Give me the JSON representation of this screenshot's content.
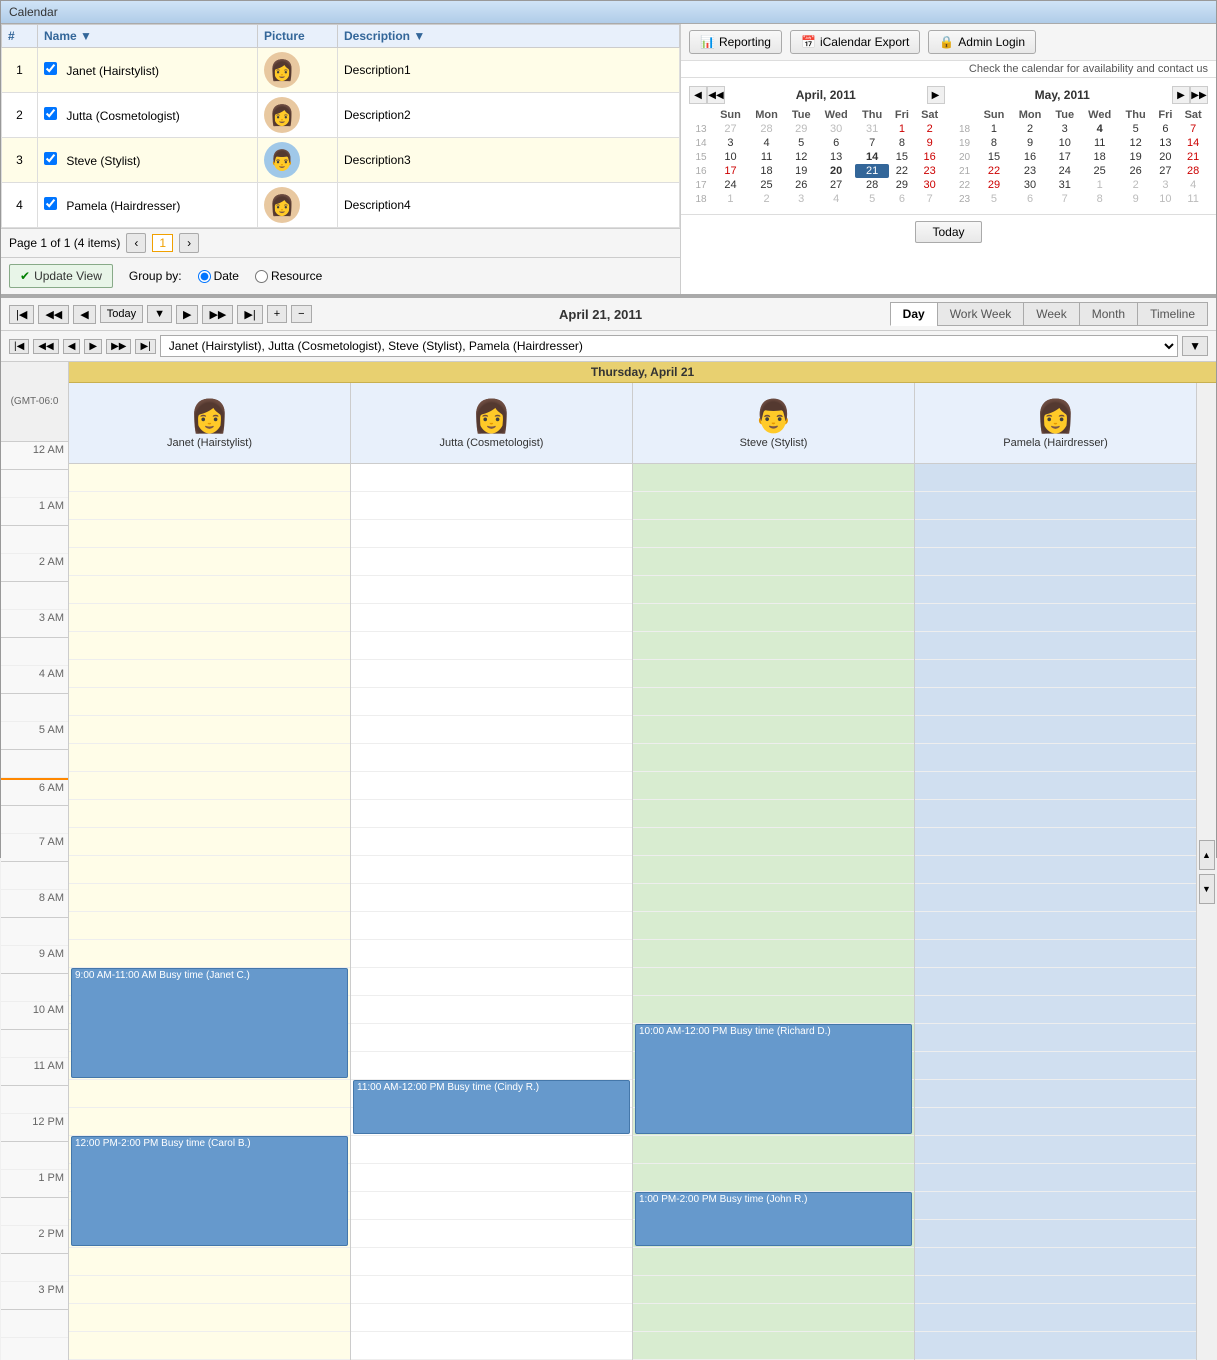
{
  "window": {
    "title": "Calendar"
  },
  "toolbar": {
    "reporting_label": "Reporting",
    "icalendar_label": "iCalendar Export",
    "admin_login_label": "Admin Login",
    "availability_text": "Check the calendar for availability and contact us"
  },
  "staff_table": {
    "columns": [
      "#",
      "Name",
      "Picture",
      "Description"
    ],
    "rows": [
      {
        "id": 1,
        "checked": true,
        "name": "Janet (Hairstylist)",
        "avatar": "👩",
        "description": "Description1",
        "gender": "female"
      },
      {
        "id": 2,
        "checked": true,
        "name": "Jutta (Cosmetologist)",
        "avatar": "👩",
        "description": "Description2",
        "gender": "female"
      },
      {
        "id": 3,
        "checked": true,
        "name": "Steve (Stylist)",
        "avatar": "👨",
        "description": "Description3",
        "gender": "male"
      },
      {
        "id": 4,
        "checked": true,
        "name": "Pamela (Hairdresser)",
        "avatar": "👩",
        "description": "Description4",
        "gender": "female"
      }
    ],
    "pagination": {
      "text": "Page 1 of 1 (4 items)",
      "current_page": "1"
    }
  },
  "controls": {
    "update_view": "Update View",
    "group_by_label": "Group by:",
    "group_date": "Date",
    "group_resource": "Resource"
  },
  "mini_calendars": {
    "april": {
      "title": "April, 2011",
      "days_header": [
        "Sun",
        "Mon",
        "Tue",
        "Wed",
        "Thu",
        "Fri",
        "Sat"
      ],
      "weeks": [
        [
          {
            "d": "27",
            "om": true
          },
          {
            "d": "28",
            "om": true
          },
          {
            "d": "29",
            "om": true
          },
          {
            "d": "30",
            "om": true
          },
          {
            "d": "31",
            "om": true
          },
          {
            "d": "1",
            "red": true
          },
          {
            "d": "2",
            "red": true
          }
        ],
        [
          {
            "d": "3"
          },
          {
            "d": "4"
          },
          {
            "d": "5"
          },
          {
            "d": "6"
          },
          {
            "d": "7"
          },
          {
            "d": "8"
          },
          {
            "d": "9",
            "red": true
          }
        ],
        [
          {
            "d": "10"
          },
          {
            "d": "11"
          },
          {
            "d": "12"
          },
          {
            "d": "13"
          },
          {
            "d": "14",
            "bold": true
          },
          {
            "d": "15"
          },
          {
            "d": "16",
            "red": true
          }
        ],
        [
          {
            "d": "17",
            "red": true
          },
          {
            "d": "18"
          },
          {
            "d": "19"
          },
          {
            "d": "20",
            "bold": true
          },
          {
            "d": "21",
            "selected": true
          },
          {
            "d": "22"
          },
          {
            "d": "23",
            "red": true
          }
        ],
        [
          {
            "d": "24"
          },
          {
            "d": "25"
          },
          {
            "d": "26"
          },
          {
            "d": "27"
          },
          {
            "d": "28"
          },
          {
            "d": "29"
          },
          {
            "d": "30",
            "red": true
          }
        ],
        [
          {
            "d": "1",
            "om": true
          },
          {
            "d": "2",
            "om": true
          },
          {
            "d": "3",
            "om": true
          },
          {
            "d": "4",
            "om": true
          },
          {
            "d": "5",
            "om": true
          },
          {
            "d": "6",
            "om": true
          },
          {
            "d": "7",
            "om": true
          }
        ]
      ],
      "week_nums": [
        "13",
        "14",
        "15",
        "16",
        "17",
        "18"
      ]
    },
    "may": {
      "title": "May, 2011",
      "days_header": [
        "Sun",
        "Mon",
        "Tue",
        "Wed",
        "Thu",
        "Fri",
        "Sat"
      ],
      "weeks": [
        [
          {
            "d": "1"
          },
          {
            "d": "2"
          },
          {
            "d": "3"
          },
          {
            "d": "4",
            "bold": true
          },
          {
            "d": "5"
          },
          {
            "d": "6"
          },
          {
            "d": "7",
            "red": true
          }
        ],
        [
          {
            "d": "8"
          },
          {
            "d": "9"
          },
          {
            "d": "10"
          },
          {
            "d": "11"
          },
          {
            "d": "12"
          },
          {
            "d": "13"
          },
          {
            "d": "14",
            "red": true
          }
        ],
        [
          {
            "d": "15"
          },
          {
            "d": "16"
          },
          {
            "d": "17"
          },
          {
            "d": "18"
          },
          {
            "d": "19"
          },
          {
            "d": "20"
          },
          {
            "d": "21",
            "red": true
          }
        ],
        [
          {
            "d": "22",
            "red": true
          },
          {
            "d": "23"
          },
          {
            "d": "24"
          },
          {
            "d": "25"
          },
          {
            "d": "26"
          },
          {
            "d": "27"
          },
          {
            "d": "28",
            "red": true
          }
        ],
        [
          {
            "d": "29",
            "red": true
          },
          {
            "d": "30"
          },
          {
            "d": "31"
          },
          {
            "d": "1",
            "om": true
          },
          {
            "d": "2",
            "om": true
          },
          {
            "d": "3",
            "om": true
          },
          {
            "d": "4",
            "om": true
          }
        ],
        [
          {
            "d": "5",
            "om": true
          },
          {
            "d": "6",
            "om": true
          },
          {
            "d": "7",
            "om": true
          },
          {
            "d": "8",
            "om": true
          },
          {
            "d": "9",
            "om": true
          },
          {
            "d": "10",
            "om": true
          },
          {
            "d": "11",
            "om": true
          }
        ]
      ],
      "week_nums": [
        "18",
        "19",
        "20",
        "21",
        "22",
        "23"
      ]
    }
  },
  "today_button": "Today",
  "calendar_nav": {
    "date_display": "April 21, 2011",
    "today_label": "Today",
    "view_tabs": [
      "Day",
      "Work Week",
      "Week",
      "Month",
      "Timeline"
    ],
    "active_tab": "Day"
  },
  "resource_selector": {
    "value": "Janet (Hairstylist), Jutta (Cosmetologist), Steve (Stylist), Pamela (Hairdresser)"
  },
  "calendar_date_strip": "Thursday, April 21",
  "timezone": "(GMT-06:0",
  "resources": [
    {
      "name": "Janet (Hairstylist)",
      "avatar": "👩",
      "col_class": "col-yellow"
    },
    {
      "name": "Jutta (Cosmetologist)",
      "avatar": "👩",
      "col_class": "col-white"
    },
    {
      "name": "Steve (Stylist)",
      "avatar": "👨",
      "col_class": "col-green"
    },
    {
      "name": "Pamela (Hairdresser)",
      "avatar": "👩",
      "col_class": "col-blue"
    }
  ],
  "time_slots": [
    "12 AM",
    "",
    "1 AM",
    "",
    "2 AM",
    "",
    "3 AM",
    "",
    "4 AM",
    "",
    "5 AM",
    "",
    "6 AM",
    "",
    "7 AM",
    "",
    "8 AM",
    "",
    "9 AM",
    "",
    "10 AM",
    "",
    "11 AM",
    "",
    "12 PM",
    "",
    "1 PM",
    "",
    "2 PM",
    "",
    "3 PM",
    ""
  ],
  "busy_events": [
    {
      "resource": 0,
      "label": "9:00 AM-11:00 AM Busy time (Janet C.)",
      "top_slot": 18,
      "span": 4
    },
    {
      "resource": 0,
      "label": "12:00 PM-2:00 PM Busy time (Carol B.)",
      "top_slot": 24,
      "span": 4
    },
    {
      "resource": 1,
      "label": "11:00 AM-12:00 PM Busy time (Cindy R.)",
      "top_slot": 22,
      "span": 2
    },
    {
      "resource": 2,
      "label": "10:00 AM-12:00 PM Busy time (Richard D.)",
      "top_slot": 20,
      "span": 4
    },
    {
      "resource": 2,
      "label": "1:00 PM-2:00 PM Busy time (John R.)",
      "top_slot": 26,
      "span": 2
    }
  ]
}
